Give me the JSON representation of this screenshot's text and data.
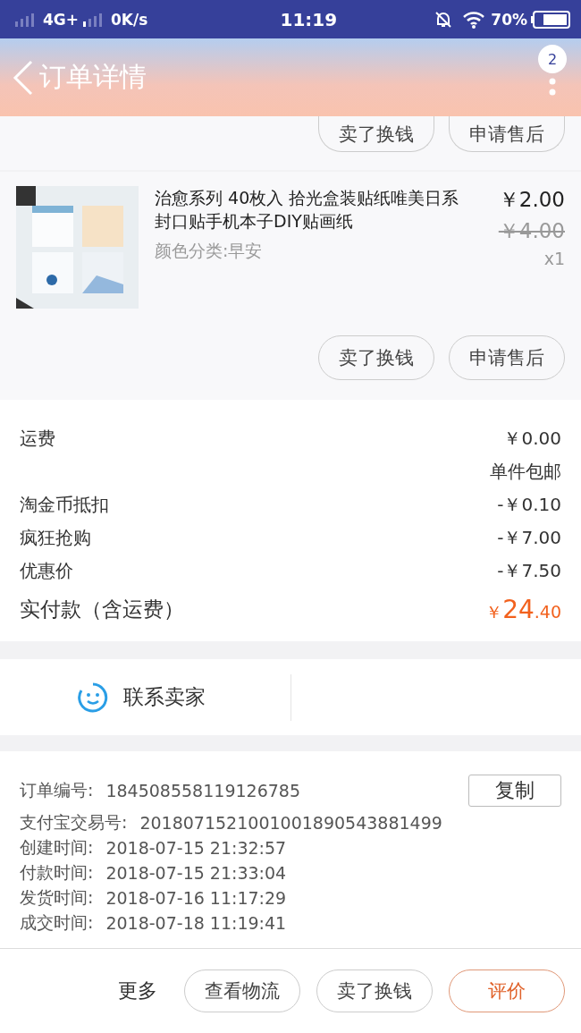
{
  "status_bar": {
    "network": "4G+",
    "speed": "0K/s",
    "time": "11:19",
    "battery": "70%"
  },
  "header": {
    "title": "订单详情",
    "badge": "2"
  },
  "previous_item_actions": [
    "卖了换钱",
    "申请售后"
  ],
  "product": {
    "title": "治愈系列 40枚入 拾光盒装贴纸唯美日系封口贴手机本子DIY贴画纸",
    "variant": "颜色分类:早安",
    "price": "￥2.00",
    "original_price": "￥4.00",
    "quantity": "x1",
    "image": {
      "kind": "picture"
    },
    "actions": [
      "卖了换钱",
      "申请售后"
    ]
  },
  "fees": [
    {
      "kind": "row",
      "label": "运费",
      "value": "￥0.00"
    },
    {
      "kind": "note",
      "value": "单件包邮"
    },
    {
      "kind": "row",
      "label": "淘金币抵扣",
      "value": "-￥0.10"
    },
    {
      "kind": "row",
      "label": "疯狂抢购",
      "value": "-￥7.00"
    },
    {
      "kind": "row",
      "label": "优惠价",
      "value": "-￥7.50"
    }
  ],
  "total": {
    "label": "实付款（含运费）",
    "currency": "￥",
    "integer": "24",
    "decimal": ".40"
  },
  "contact": {
    "label": "联系卖家"
  },
  "order_info": [
    {
      "label": "订单编号:",
      "value": "184508558119126785",
      "copy": "复制"
    },
    {
      "label": "支付宝交易号:",
      "value": "2018071521001001890543881499"
    },
    {
      "label": "创建时间:",
      "value": "2018-07-15 21:32:57"
    },
    {
      "label": "付款时间:",
      "value": "2018-07-15 21:33:04"
    },
    {
      "label": "发货时间:",
      "value": "2018-07-16 11:17:29"
    },
    {
      "label": "成交时间:",
      "value": "2018-07-18 11:19:41"
    }
  ],
  "bottom_bar": {
    "more": "更多",
    "buttons": [
      {
        "label": "查看物流",
        "kind": "plain"
      },
      {
        "label": "卖了换钱",
        "kind": "plain"
      },
      {
        "label": "评价",
        "kind": "primary"
      }
    ]
  }
}
